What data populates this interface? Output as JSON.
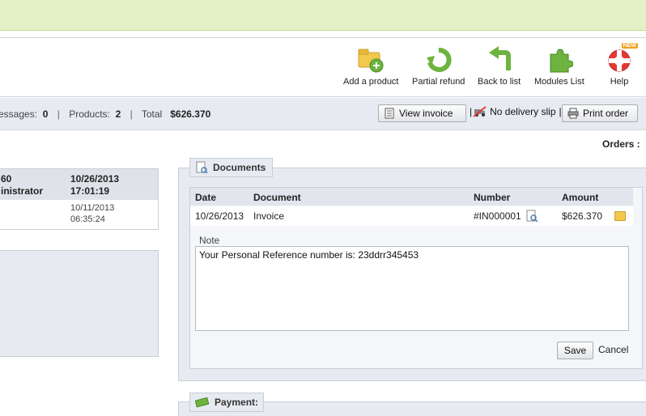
{
  "toolbar": {
    "items": [
      {
        "label": "Add a product"
      },
      {
        "label": "Partial refund"
      },
      {
        "label": "Back to list"
      },
      {
        "label": "Modules List"
      },
      {
        "label": "Help"
      }
    ],
    "help_badge": "NEW"
  },
  "summary": {
    "messages_label": "essages:",
    "messages_value": "0",
    "products_label": "Products:",
    "products_value": "2",
    "total_label": "Total",
    "total_value": "$626.370",
    "separator": "|",
    "view_invoice": "View invoice",
    "no_delivery": "No delivery slip",
    "print_order": "Print order"
  },
  "orders_label": "Orders :",
  "left_table": {
    "row1_col1_line1": "60",
    "row1_col1_line2": "inistrator",
    "row1_col2_line1": "10/26/2013",
    "row1_col2_line2": "17:01:19",
    "row2_col2_line1": "10/11/2013",
    "row2_col2_line2": "06:35:24"
  },
  "documents": {
    "legend": "Documents",
    "headers": {
      "date": "Date",
      "document": "Document",
      "number": "Number",
      "amount": "Amount"
    },
    "row": {
      "date": "10/26/2013",
      "document": "Invoice",
      "number": "#IN000001",
      "amount": "$626.370"
    },
    "note_label": "Note",
    "note_value": "Your Personal Reference number is: 23ddrr345453",
    "save": "Save",
    "cancel": "Cancel"
  },
  "payment": {
    "legend": "Payment:"
  },
  "colors": {
    "top_band": "#e2f1c6",
    "panel": "#e7ebf1",
    "icon_green": "#6db33f",
    "icon_yellow": "#f2c94c"
  }
}
